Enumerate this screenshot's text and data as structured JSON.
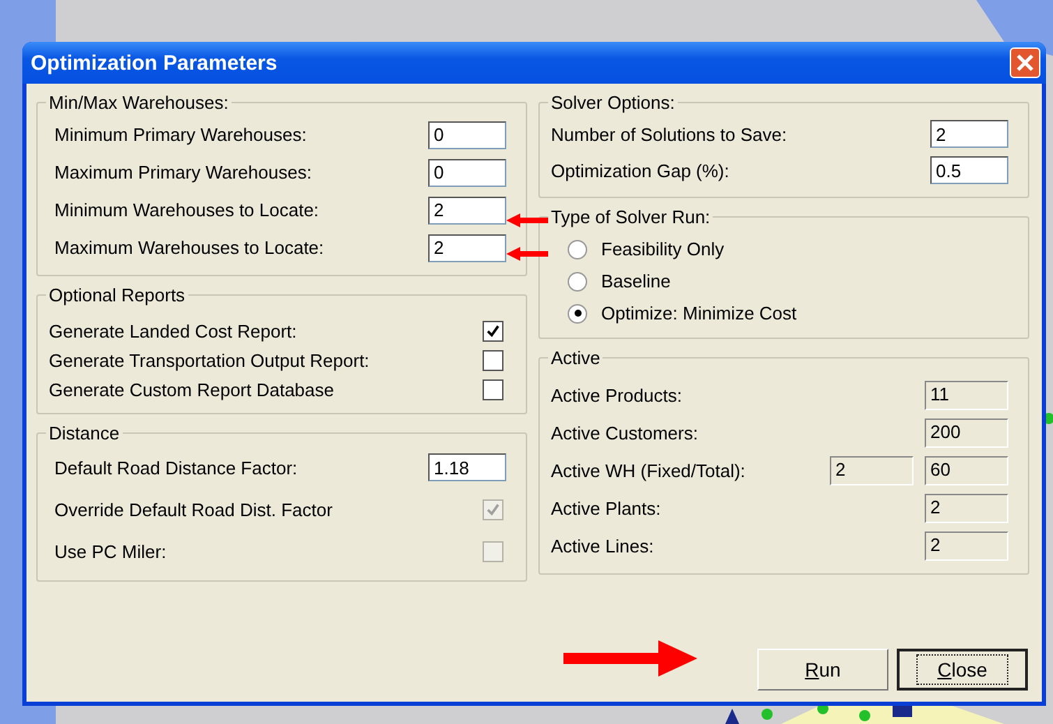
{
  "window": {
    "title": "Optimization Parameters"
  },
  "warehouses": {
    "title": "Min/Max Warehouses:",
    "fields": [
      {
        "label": "Minimum Primary Warehouses:",
        "value": "0"
      },
      {
        "label": "Maximum Primary Warehouses:",
        "value": "0"
      },
      {
        "label": "Minimum Warehouses to Locate:",
        "value": "2"
      },
      {
        "label": "Maximum Warehouses to Locate:",
        "value": "2"
      }
    ]
  },
  "reports": {
    "title": "Optional Reports",
    "items": [
      {
        "label": "Generate Landed Cost Report:",
        "checked": true,
        "disabled": false
      },
      {
        "label": "Generate Transportation Output Report:",
        "checked": false,
        "disabled": false
      },
      {
        "label": "Generate Custom Report Database",
        "checked": false,
        "disabled": false
      }
    ]
  },
  "distance": {
    "title": "Distance",
    "items": [
      {
        "kind": "field",
        "label": "Default Road Distance Factor:",
        "value": "1.18"
      },
      {
        "kind": "checkbox",
        "label": "Override Default Road Dist. Factor",
        "checked": true,
        "disabled": true
      },
      {
        "kind": "checkbox",
        "label": "Use PC Miler:",
        "checked": false,
        "disabled": true
      }
    ]
  },
  "solver_options": {
    "title": "Solver Options:",
    "fields": [
      {
        "label": "Number of Solutions to Save:",
        "value": "2"
      },
      {
        "label": "Optimization Gap (%):",
        "value": "0.5"
      }
    ]
  },
  "run_type": {
    "title": "Type of Solver Run:",
    "options": [
      {
        "label": "Feasibility Only",
        "selected": false
      },
      {
        "label": "Baseline",
        "selected": false
      },
      {
        "label": "Optimize: Minimize Cost",
        "selected": true
      }
    ]
  },
  "active": {
    "title": "Active",
    "rows": [
      {
        "label": "Active Products:",
        "values": [
          "11"
        ]
      },
      {
        "label": "Active Customers:",
        "values": [
          "200"
        ]
      },
      {
        "label": "Active WH (Fixed/Total):",
        "values": [
          "2",
          "60"
        ]
      },
      {
        "label": "Active Plants:",
        "values": [
          "2"
        ]
      },
      {
        "label": "Active Lines:",
        "values": [
          "2"
        ]
      }
    ]
  },
  "buttons": [
    {
      "label": "Run",
      "focused": false
    },
    {
      "label": "Close",
      "focused": true
    }
  ]
}
